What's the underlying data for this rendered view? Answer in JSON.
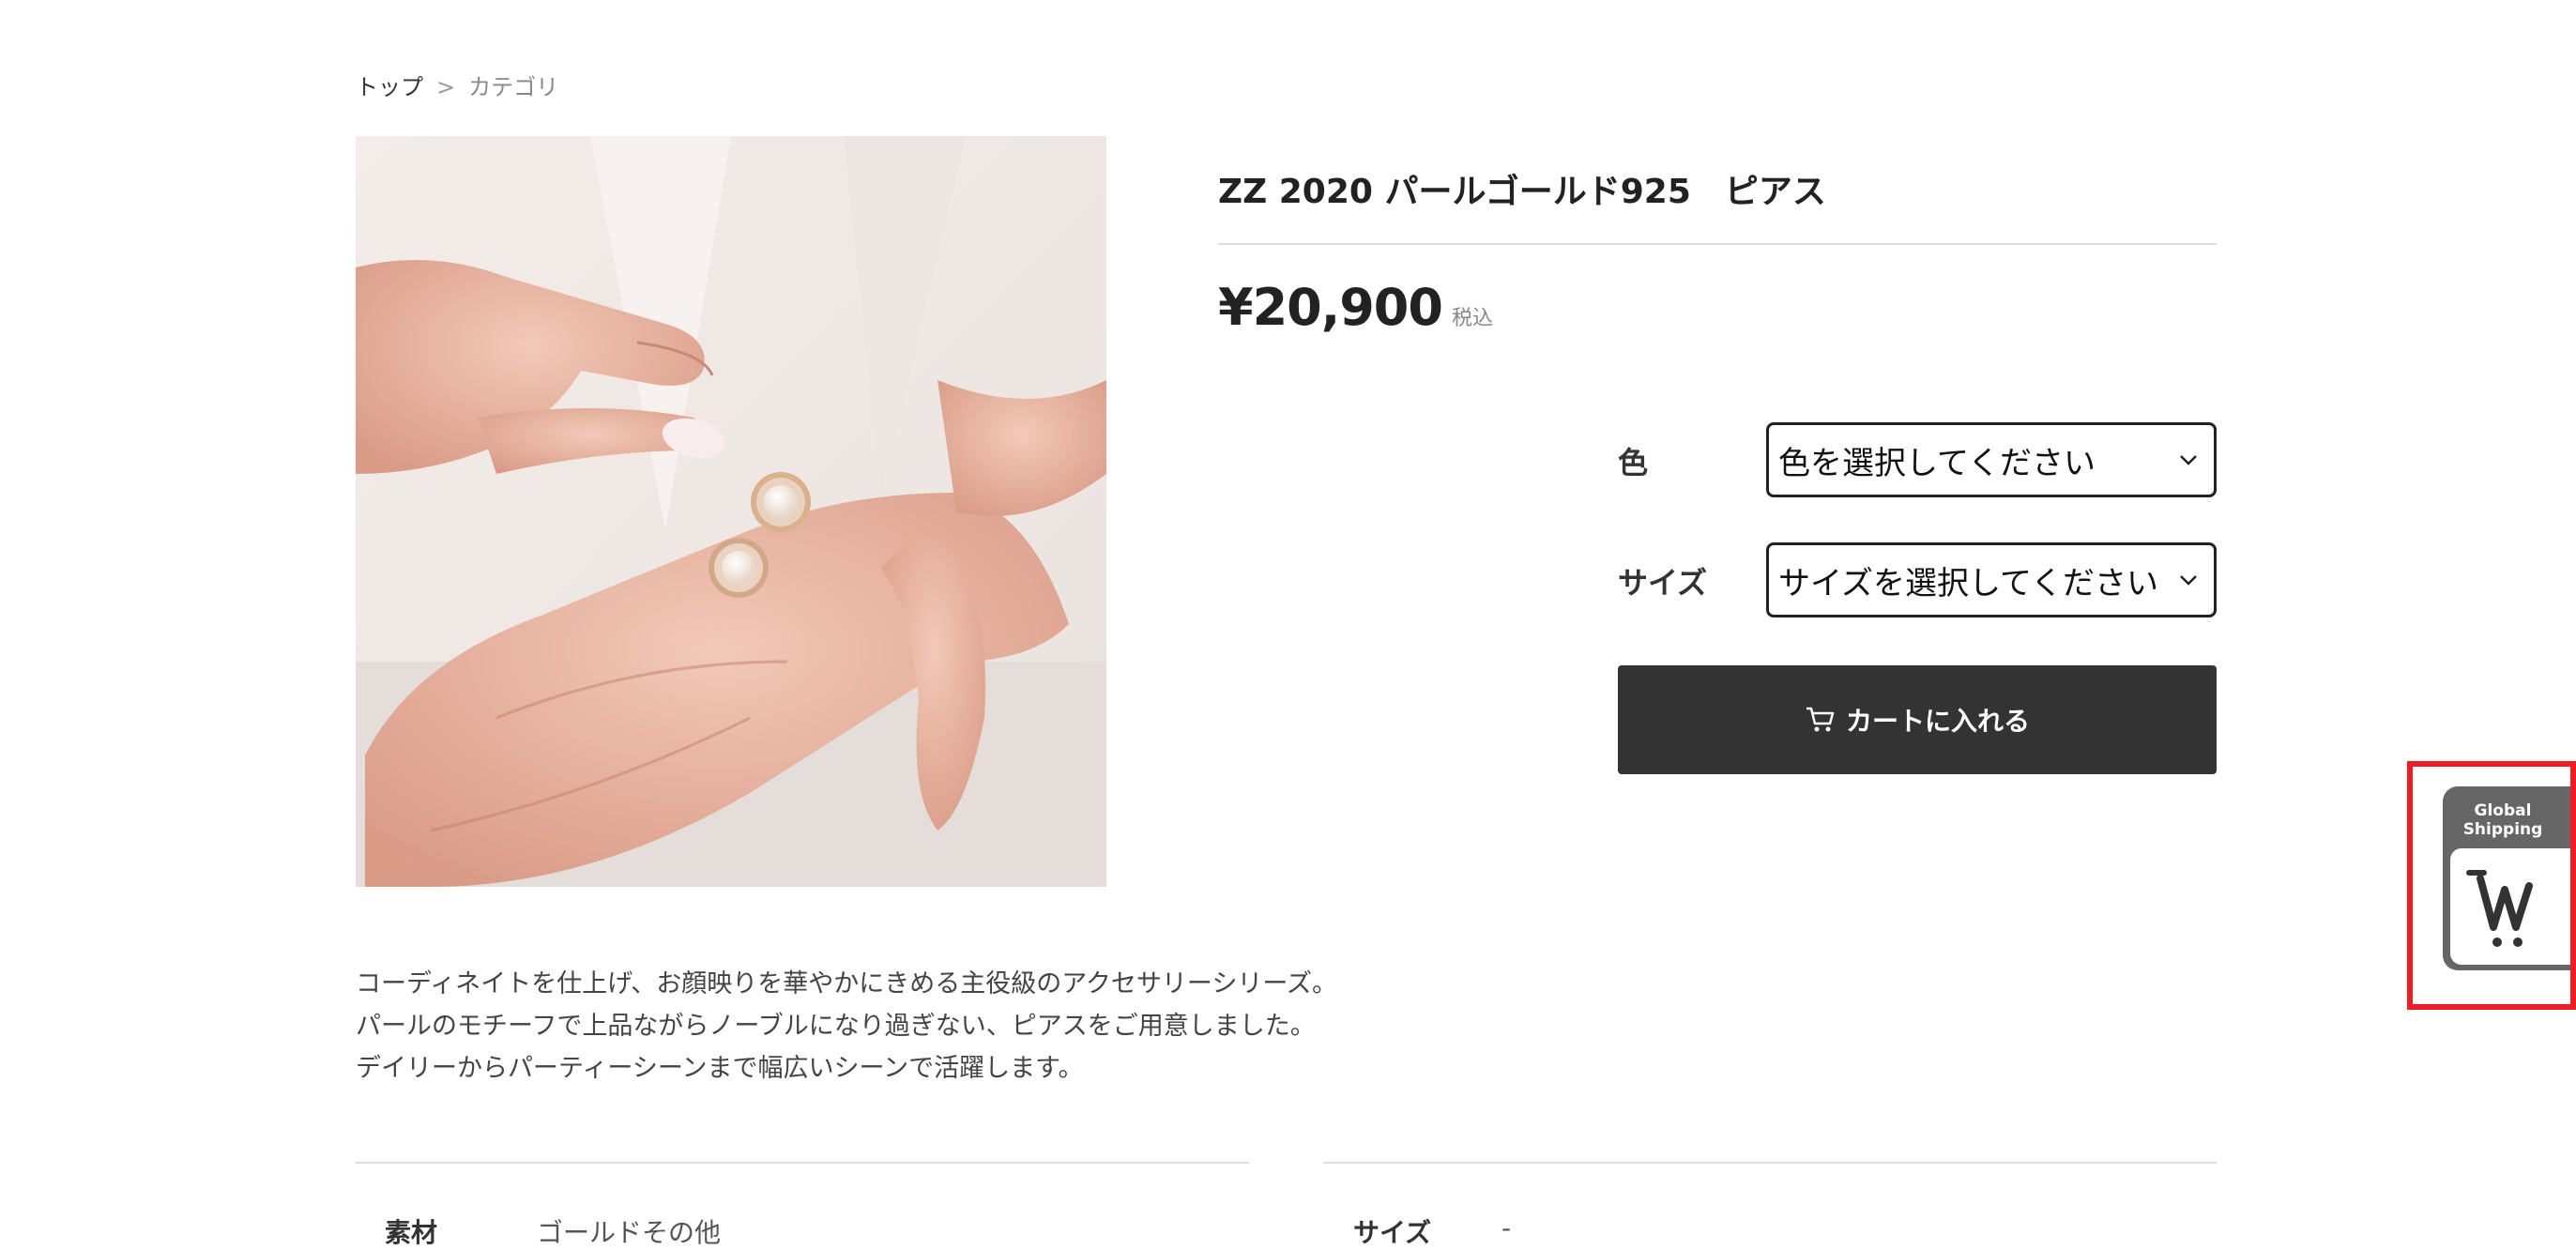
{
  "breadcrumb": {
    "home": "トップ",
    "separator": ">",
    "current": "カテゴリ"
  },
  "product": {
    "title": "ZZ 2020 パールゴールド925　ピアス",
    "price": "¥20,900",
    "tax_label": "税込",
    "image_alt": "earrings-photo"
  },
  "options": [
    {
      "label": "色",
      "value": "色を選択してください"
    },
    {
      "label": "サイズ",
      "value": "サイズを選択してください"
    }
  ],
  "cart_button": {
    "label": "カートに入れる",
    "icon": "cart-icon"
  },
  "description": [
    "コーディネイトを仕上げ、お顔映りを華やかにきめる主役級のアクセサリーシリーズ。",
    "パールのモチーフで上品ながらノーブルになり過ぎない、ピアスをご用意しました。",
    "デイリーからパーティーシーンまで幅広いシーンで活躍します。"
  ],
  "specs": {
    "left_label": "素材",
    "left_value": "ゴールドその他",
    "right_label": "サイズ",
    "right_value": "-"
  },
  "shipping_widget": {
    "label_line1": "Global",
    "label_line2": "Shipping",
    "icon": "worldshopping-cart-icon"
  },
  "colors": {
    "cart_button": "#333333",
    "highlight": "#ee1c25",
    "widget": "#666666"
  }
}
